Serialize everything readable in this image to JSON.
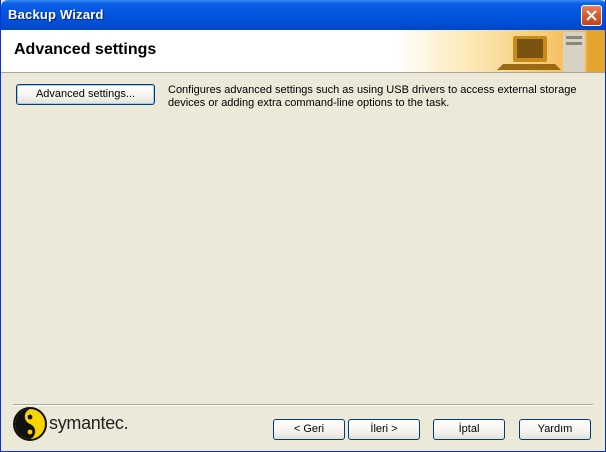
{
  "window": {
    "title": "Backup Wizard"
  },
  "header": {
    "title": "Advanced settings"
  },
  "main": {
    "advanced_button": "Advanced settings...",
    "description": "Configures advanced settings such as using USB drivers to access external storage devices or adding extra command-line options to the task."
  },
  "footer": {
    "brand": "symantec.",
    "back_button": "< Geri",
    "next_button": "İleri >",
    "cancel_button": "İptal",
    "help_button": "Yardım"
  },
  "colors": {
    "titlebar": "#0054E3",
    "dialog_background": "#ECE9D8",
    "brand_yellow": "#F6D500"
  }
}
